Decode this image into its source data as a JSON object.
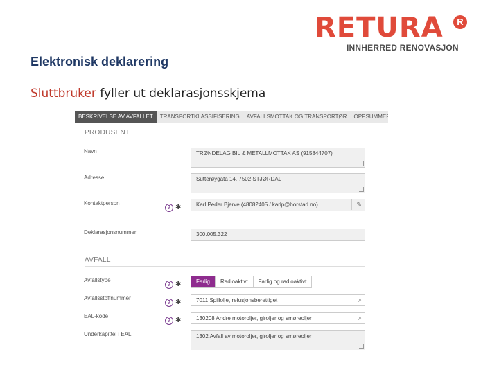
{
  "logo": {
    "wordmark": "RETURA",
    "mark": "R",
    "tagline": "INNHERRED RENOVASJON",
    "colors": {
      "brand": "#e04a3a",
      "mark": "#e04a3a"
    }
  },
  "header": {
    "title": "Elektronisk deklarering",
    "subtitle_accent": "Sluttbruker",
    "subtitle_rest": " fyller ut deklarasjonsskjema"
  },
  "tabs": [
    {
      "label": "BESKRIVELSE AV AVFALLET",
      "active": true
    },
    {
      "label": "TRANSPORTKLASSIFISERING",
      "active": false
    },
    {
      "label": "AVFALLSMOTTAK OG TRANSPORTØR",
      "active": false
    },
    {
      "label": "OPPSUMMERING OG",
      "active": false
    }
  ],
  "produsent": {
    "section_title": "PRODUSENT",
    "name_label": "Navn",
    "name_value": "TRØNDELAG BIL & METALLMOTTAK AS (915844707)",
    "address_label": "Adresse",
    "address_value": "Sutterøygata 14, 7502 STJØRDAL",
    "contact_label": "Kontaktperson",
    "contact_value": "Karl Peder Bjerve (48082405 / karlp@borstad.no)",
    "declaration_label": "Deklarasjonsnummer",
    "declaration_value": "300.005.322"
  },
  "avfall": {
    "section_title": "AVFALL",
    "type_label": "Avfallstype",
    "type_options": [
      "Farlig",
      "Radioaktivt",
      "Farlig og radioaktivt"
    ],
    "type_selected": "Farlig",
    "number_label": "Avfallsstoffnummer",
    "number_value": "7011 Spillolje, refusjonsberettiget",
    "eal_label": "EAL-kode",
    "eal_value": "130208 Andre motoroljer, giroljer og smøreoljer",
    "subchapter_label": "Underkapittel i EAL",
    "subchapter_value": "1302 Avfall av motoroljer, giroljer og smøreoljer"
  },
  "icons": {
    "help": "?",
    "required": "✱",
    "pencil": "✎",
    "search": "⌕"
  },
  "colors": {
    "accent": "#8e2c8e",
    "active_tab": "#555555",
    "title": "#1f3864"
  }
}
